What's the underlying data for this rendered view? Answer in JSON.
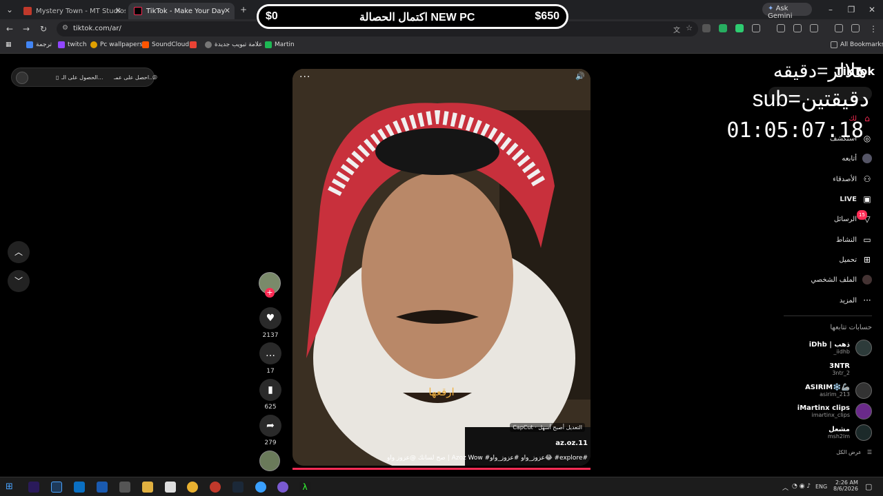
{
  "browser": {
    "tabs": [
      {
        "title": "Mystery Town - MT Studios | M",
        "active": false
      },
      {
        "title": "TikTok - Make Your Day",
        "active": true
      }
    ],
    "ask_gemini": "Ask Gemini",
    "url": "tiktok.com/ar/",
    "bookmarks": [
      "ترجمة",
      "twitch",
      "Pc wallpapers",
      "SoundCloud",
      "علامة تبويب جديدة",
      "Martin"
    ],
    "all_bookmarks": "All Bookmarks"
  },
  "banner": {
    "left": "$0",
    "center": "اكتمال الحصالة NEW PC",
    "right": "$650"
  },
  "stream_overlay": {
    "line1": "هلالر=دقيقه",
    "line2": "sub=دقيقتين",
    "timer": "01:05:07:18"
  },
  "top_left_pill": {
    "item1": "احصل على عمـ...",
    "item2": "الحصول على الـ..."
  },
  "video": {
    "caption_overlay": "ارقعها",
    "capcut_label": "CapCut · التعديل أصبح أسهل",
    "author": "az.oz.11",
    "description": "صح لسانك @عزوز واو | Azoz Wow #عزوز_واو #عزوز_واو😂 #explore#"
  },
  "actions": {
    "likes": "2137",
    "comments": "17",
    "saves": "625",
    "shares": "279"
  },
  "sidebar": {
    "logo": "TikTok",
    "nav": [
      {
        "label": "لك",
        "icon": "home-icon"
      },
      {
        "label": "استكشف",
        "icon": "compass-icon"
      },
      {
        "label": "أتابعه",
        "icon": "following-icon"
      },
      {
        "label": "الأصدقاء",
        "icon": "friends-icon"
      },
      {
        "label": "LIVE",
        "icon": "live-icon"
      },
      {
        "label": "الرسائل",
        "icon": "messages-icon",
        "badge": "15"
      },
      {
        "label": "النشاط",
        "icon": "activity-icon"
      },
      {
        "label": "تحميل",
        "icon": "upload-icon"
      },
      {
        "label": "الملف الشخصي",
        "icon": "profile-icon"
      },
      {
        "label": "المزيد",
        "icon": "more-icon"
      }
    ],
    "following_title": "حسابات تتابعها",
    "accounts": [
      {
        "name": "iDhb | ذهب",
        "handle": "_iidhb"
      },
      {
        "name": "3NTR",
        "handle": "3ntr_2"
      },
      {
        "name": "ASIRIM❄️🦾",
        "handle": "asirim_213"
      },
      {
        "name": "iMartinx clips",
        "handle": "imartinx_clips"
      },
      {
        "name": "مشعل",
        "handle": "msh2lm"
      }
    ],
    "see_all": "عرض الكل"
  },
  "taskbar": {
    "lang": "ENG",
    "time": "2:26 AM",
    "date": "8/6/2026"
  },
  "colors": {
    "accent": "#fe2c55",
    "bg": "#000000"
  }
}
